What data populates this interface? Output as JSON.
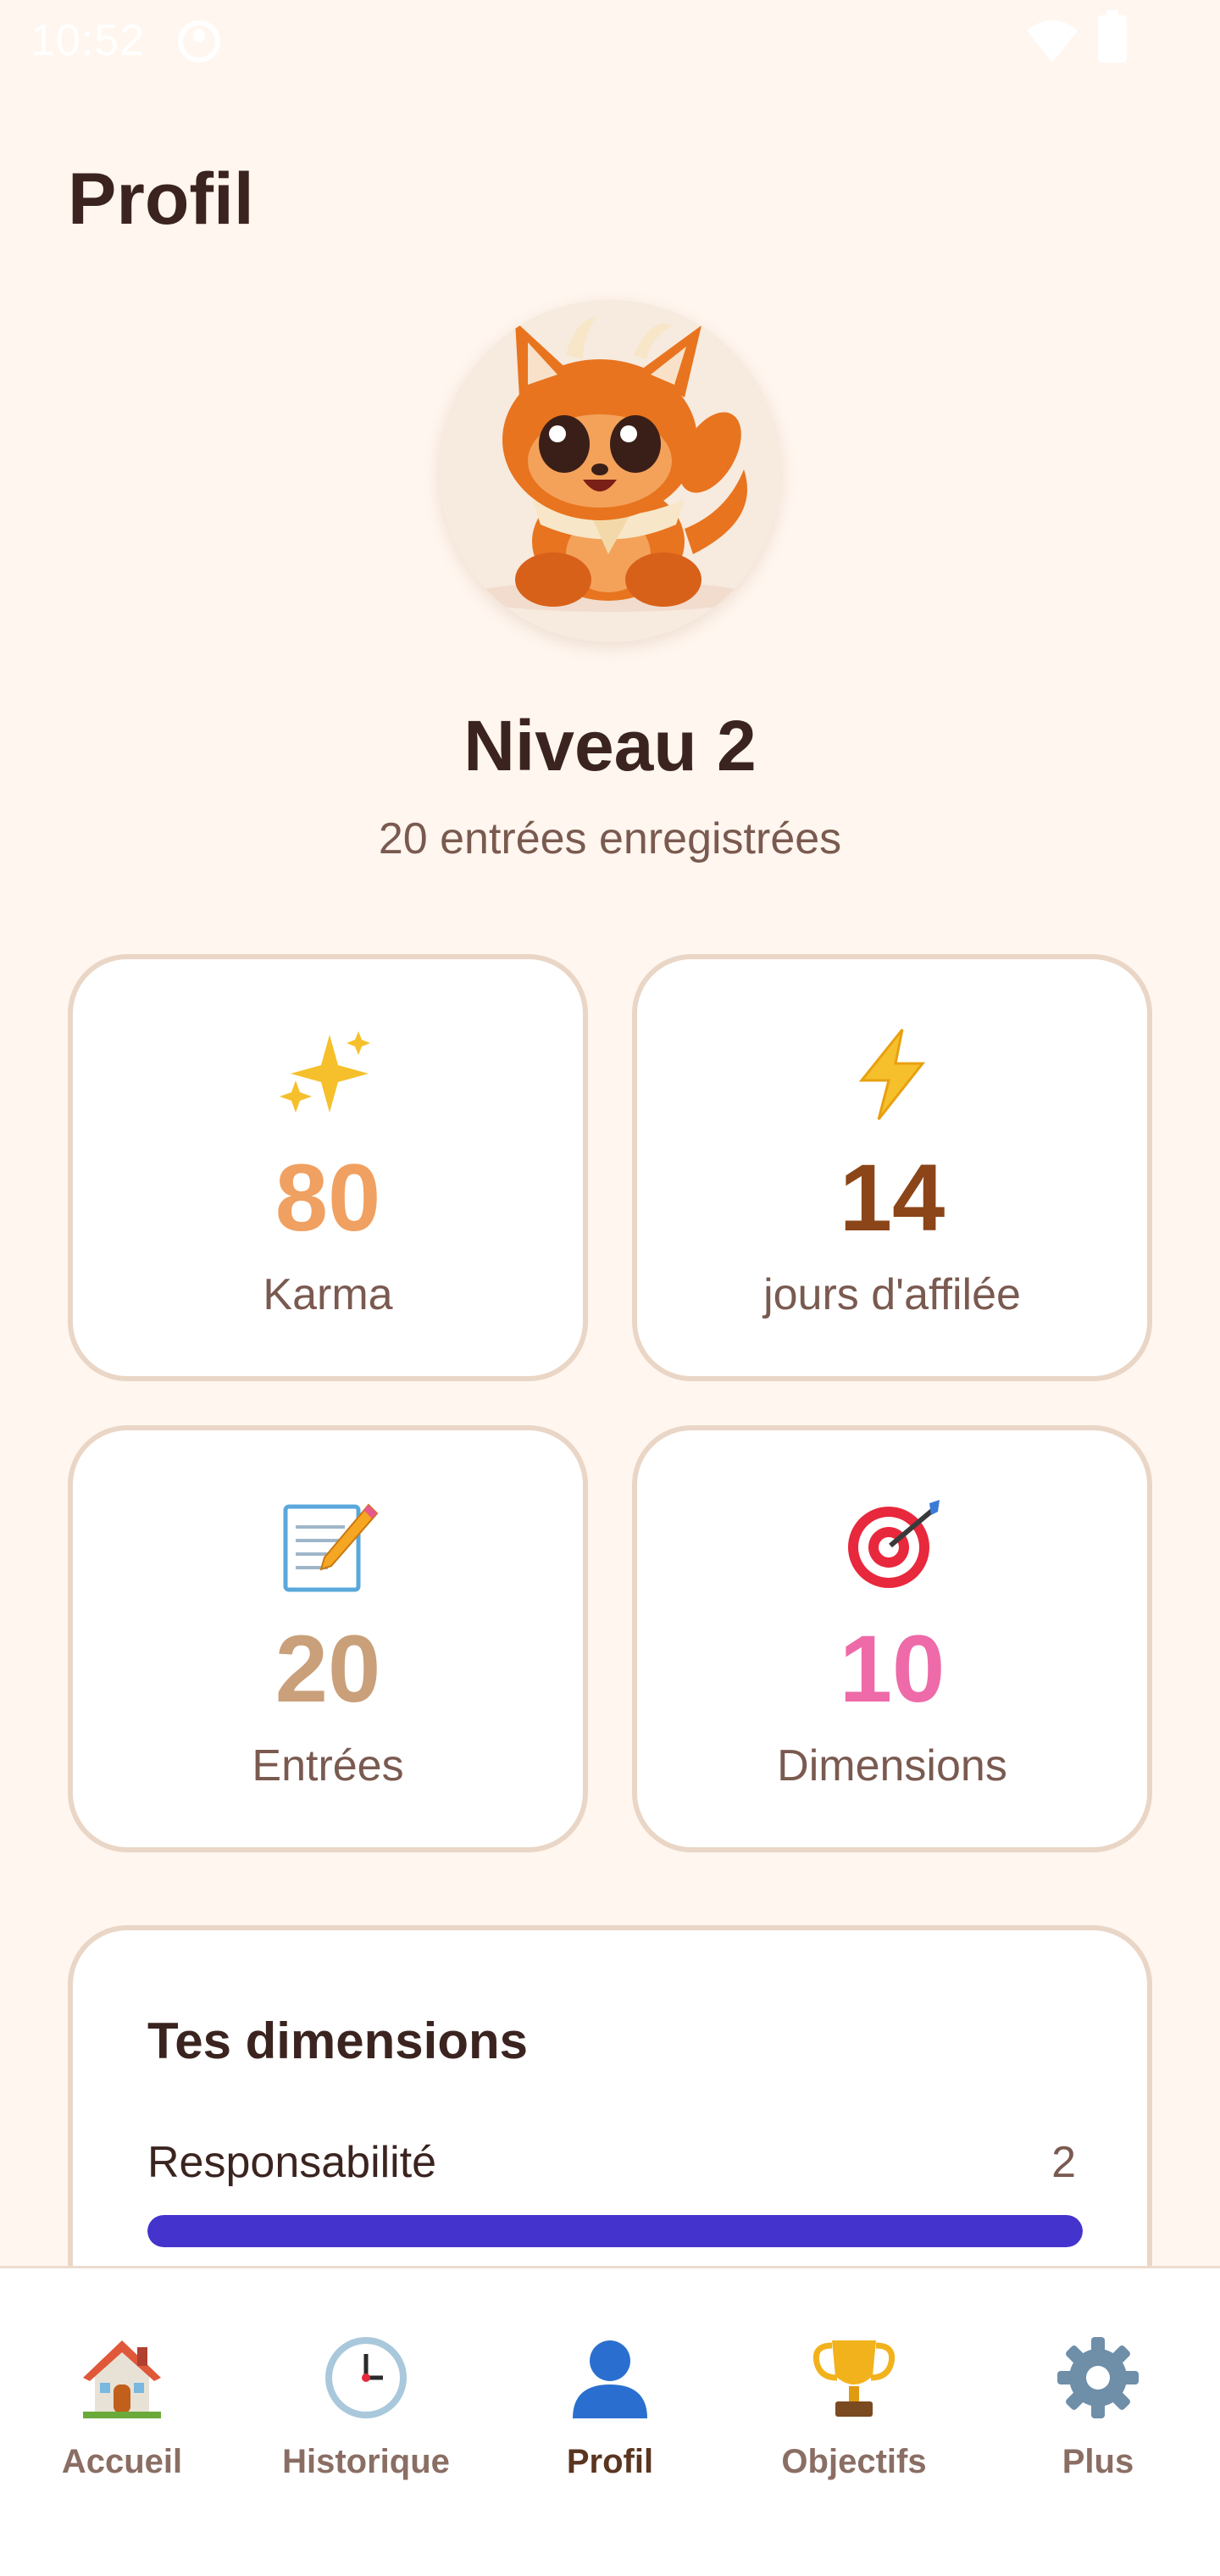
{
  "status_bar": {
    "time": "10:52"
  },
  "page": {
    "title": "Profil"
  },
  "profile": {
    "avatar_icon": "fox-mascot-icon",
    "level": "Niveau 2",
    "entries_summary": "20 entrées enregistrées"
  },
  "stats": [
    {
      "icon": "sparkles-icon",
      "value": "80",
      "label": "Karma",
      "color": "#f0a060"
    },
    {
      "icon": "lightning-icon",
      "value": "14",
      "label": "jours d'affilée",
      "color": "#8b4518"
    },
    {
      "icon": "memo-icon",
      "value": "20",
      "label": "Entrées",
      "color": "#c9a07a"
    },
    {
      "icon": "target-icon",
      "value": "10",
      "label": "Dimensions",
      "color": "#ee6aa8"
    }
  ],
  "dimensions": {
    "title": "Tes dimensions",
    "items": [
      {
        "label": "Responsabilité",
        "value": "2",
        "fill": 1.0,
        "color": "#4433cc"
      }
    ]
  },
  "nav": {
    "items": [
      {
        "label": "Accueil",
        "icon": "house-icon",
        "active": false
      },
      {
        "label": "Historique",
        "icon": "clock-icon",
        "active": false
      },
      {
        "label": "Profil",
        "icon": "user-icon",
        "active": true
      },
      {
        "label": "Objectifs",
        "icon": "trophy-icon",
        "active": false
      },
      {
        "label": "Plus",
        "icon": "gear-icon",
        "active": false
      }
    ]
  }
}
